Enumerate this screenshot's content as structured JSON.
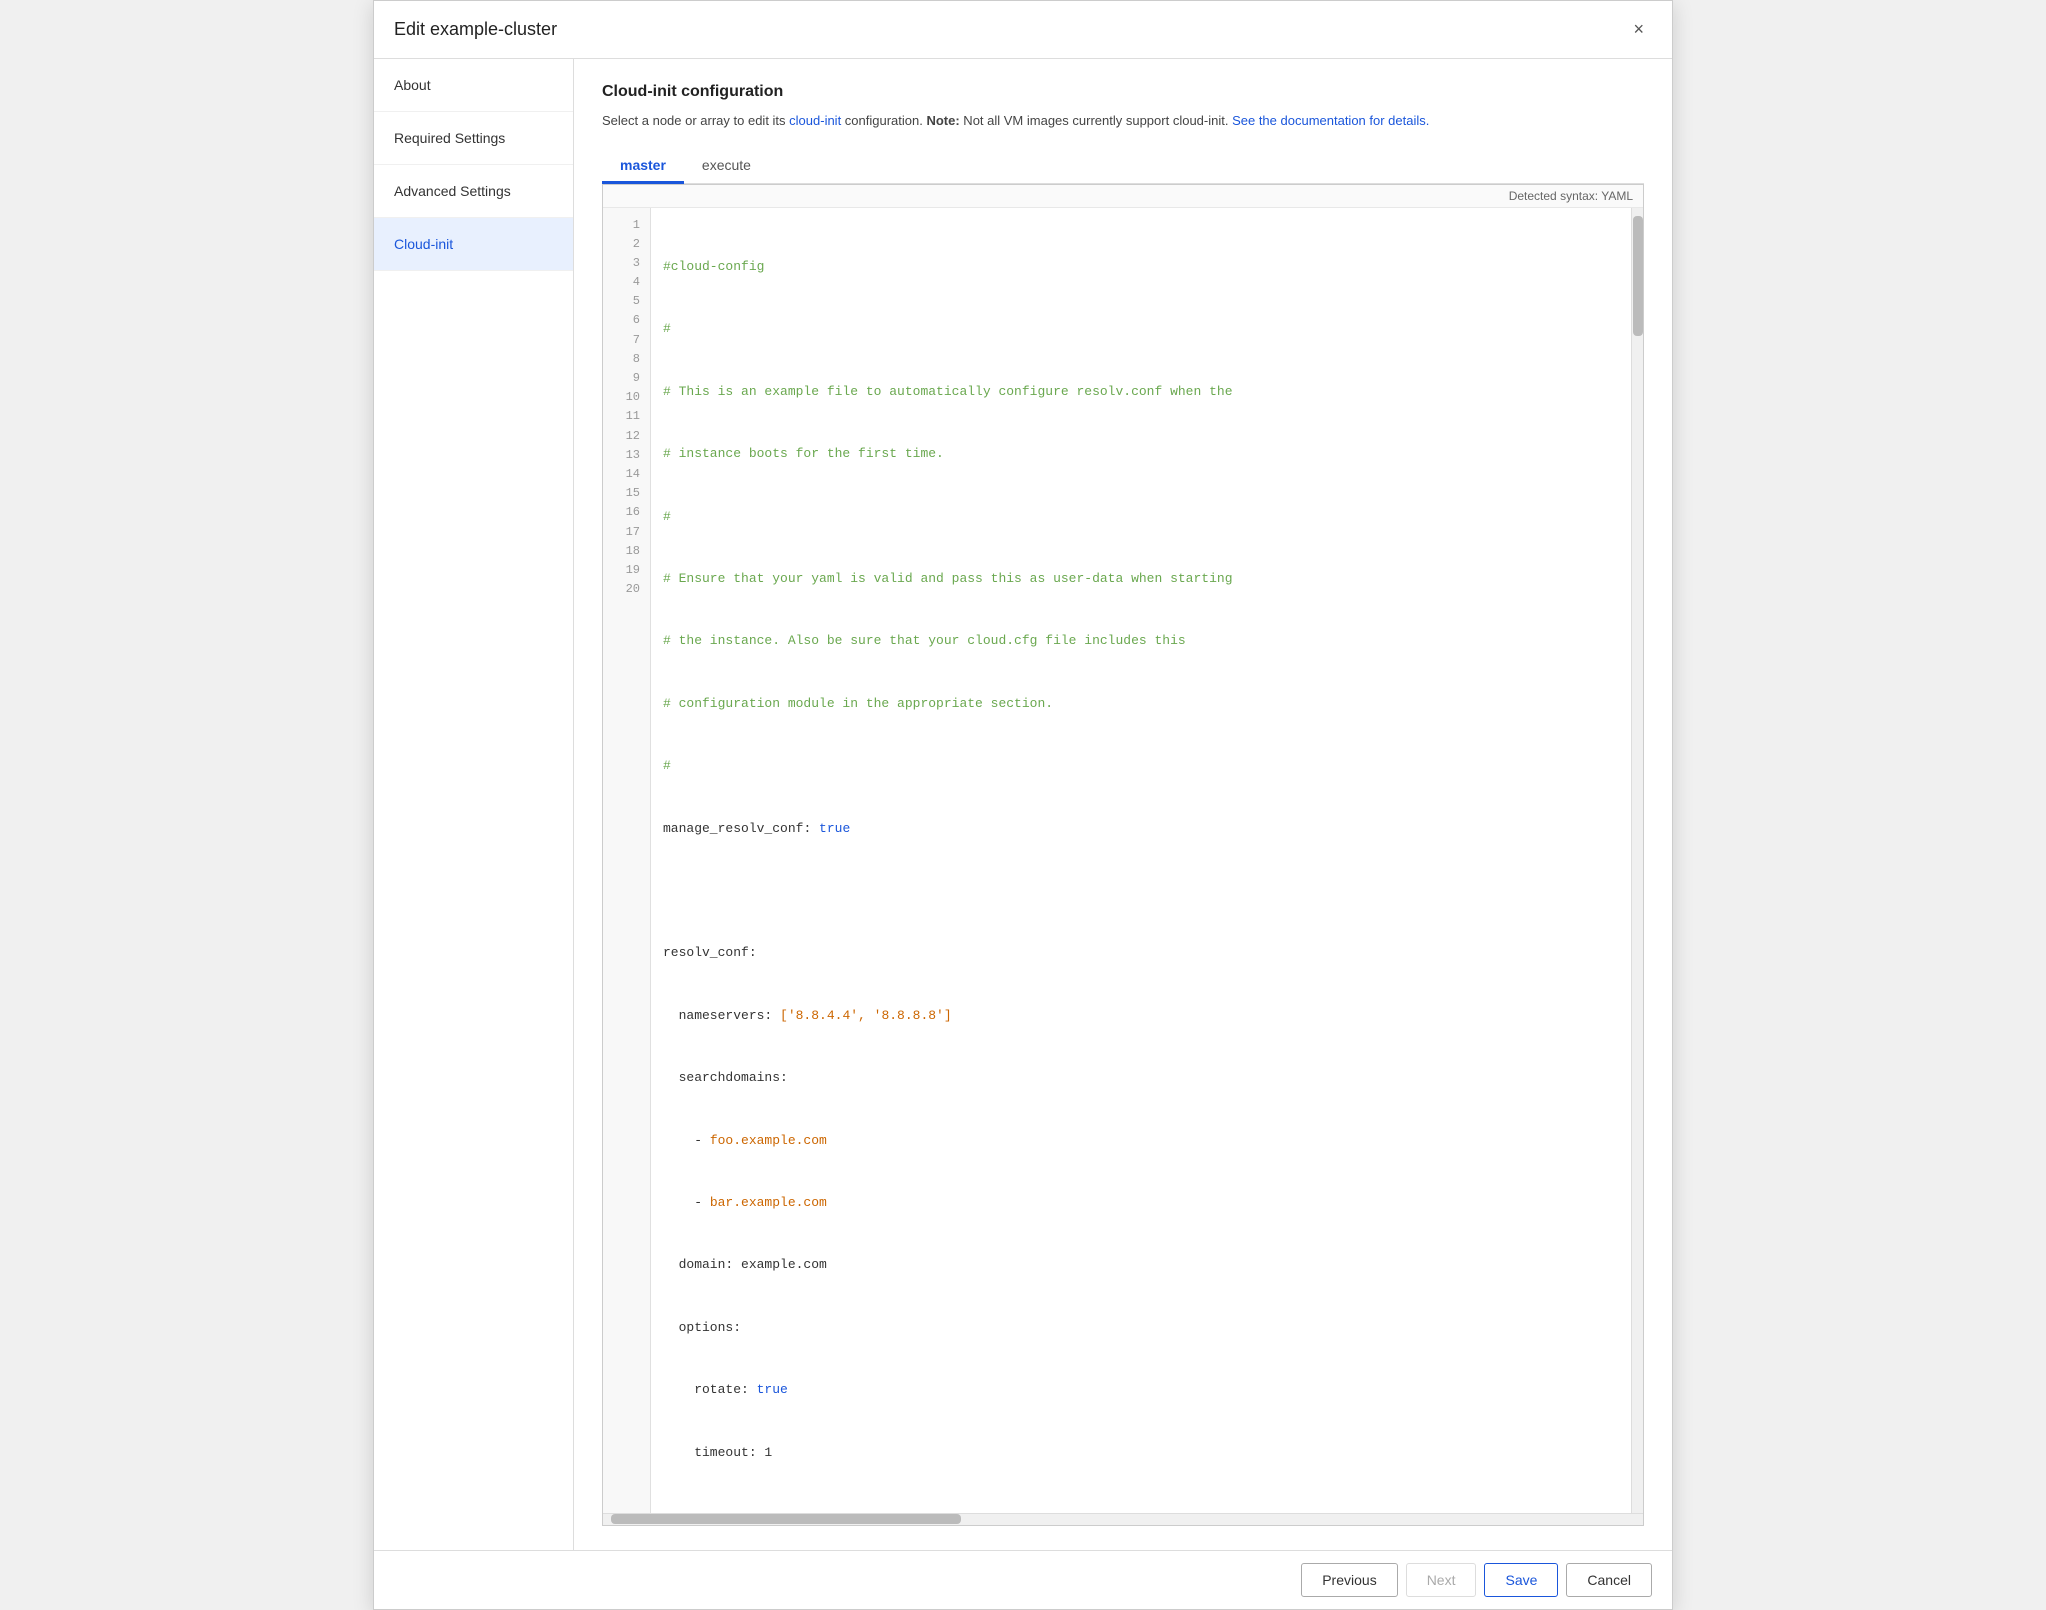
{
  "dialog": {
    "title": "Edit example-cluster",
    "close_label": "×"
  },
  "sidebar": {
    "items": [
      {
        "id": "about",
        "label": "About",
        "active": false
      },
      {
        "id": "required-settings",
        "label": "Required Settings",
        "active": false
      },
      {
        "id": "advanced-settings",
        "label": "Advanced Settings",
        "active": false
      },
      {
        "id": "cloud-init",
        "label": "Cloud-init",
        "active": true
      }
    ]
  },
  "main": {
    "section_title": "Cloud-init configuration",
    "description_part1": "Select a node or array to edit its ",
    "description_link1": "cloud-init",
    "description_part2": " configuration. ",
    "description_bold": "Note:",
    "description_part3": " Not all VM images currently support cloud-init. ",
    "description_link2": "See the documentation for details.",
    "tabs": [
      {
        "id": "master",
        "label": "master",
        "active": true
      },
      {
        "id": "execute",
        "label": "execute",
        "active": false
      }
    ],
    "editor": {
      "status": "Detected syntax: YAML",
      "lines": [
        {
          "num": 1,
          "content": "#cloud-config",
          "type": "comment"
        },
        {
          "num": 2,
          "content": "#",
          "type": "comment"
        },
        {
          "num": 3,
          "content": "# This is an example file to automatically configure resolv.conf when the",
          "type": "comment"
        },
        {
          "num": 4,
          "content": "# instance boots for the first time.",
          "type": "comment"
        },
        {
          "num": 5,
          "content": "#",
          "type": "comment"
        },
        {
          "num": 6,
          "content": "# Ensure that your yaml is valid and pass this as user-data when starting",
          "type": "comment"
        },
        {
          "num": 7,
          "content": "# the instance. Also be sure that your cloud.cfg file includes this",
          "type": "comment"
        },
        {
          "num": 8,
          "content": "# configuration module in the appropriate section.",
          "type": "comment"
        },
        {
          "num": 9,
          "content": "#",
          "type": "comment"
        },
        {
          "num": 10,
          "content": "manage_resolv_conf: true",
          "type": "key-bool"
        },
        {
          "num": 11,
          "content": "",
          "type": "blank"
        },
        {
          "num": 12,
          "content": "resolv_conf:",
          "type": "key-only"
        },
        {
          "num": 13,
          "content": "  nameservers: ['8.8.4.4', '8.8.8.8']",
          "type": "key-array"
        },
        {
          "num": 14,
          "content": "  searchdomains:",
          "type": "key-indent"
        },
        {
          "num": 15,
          "content": "    - foo.example.com",
          "type": "list-item"
        },
        {
          "num": 16,
          "content": "    - bar.example.com",
          "type": "list-item"
        },
        {
          "num": 17,
          "content": "  domain: example.com",
          "type": "key-val"
        },
        {
          "num": 18,
          "content": "  options:",
          "type": "key-indent"
        },
        {
          "num": 19,
          "content": "    rotate: true",
          "type": "key-bool-indent"
        },
        {
          "num": 20,
          "content": "    timeout: 1",
          "type": "key-num-indent"
        }
      ]
    }
  },
  "footer": {
    "previous_label": "Previous",
    "next_label": "Next",
    "save_label": "Save",
    "cancel_label": "Cancel"
  }
}
